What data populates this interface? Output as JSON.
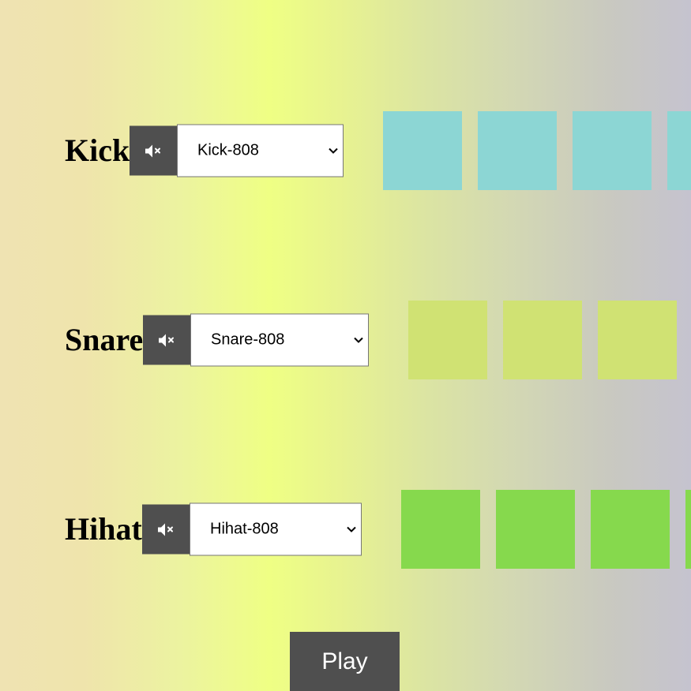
{
  "tracks": [
    {
      "name": "Kick",
      "selected_sound": "Kick-808",
      "mute_icon": "volume-mute-icon",
      "pad_color": "#8cd6d4"
    },
    {
      "name": "Snare",
      "selected_sound": "Snare-808",
      "mute_icon": "volume-mute-icon",
      "pad_color": "#d0e273"
    },
    {
      "name": "Hihat",
      "selected_sound": "Hihat-808",
      "mute_icon": "volume-mute-icon",
      "pad_color": "#86d94d"
    }
  ],
  "play_button": {
    "label": "Play"
  }
}
